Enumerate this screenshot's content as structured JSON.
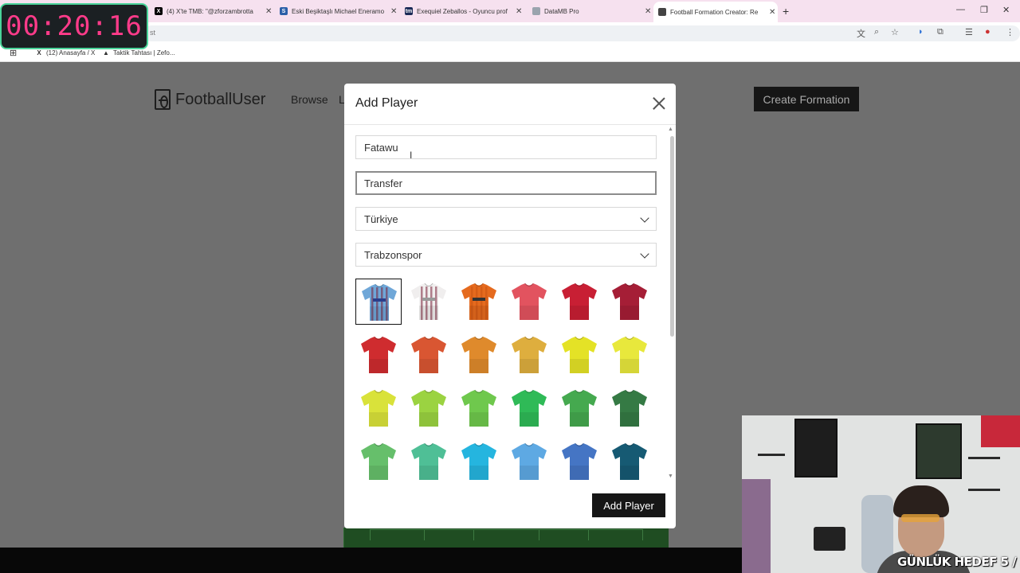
{
  "timer": {
    "text": "00:20:16"
  },
  "browser": {
    "tabs": [
      {
        "title": "(4) X'te TMB: \"@zforzambrotta",
        "icon": "x-icon",
        "fav_bg": "#000000",
        "fav_glyph": "X"
      },
      {
        "title": "Eski Beşiktaşlı Michael Eneramo",
        "icon": "news-icon",
        "fav_bg": "#2b5fa8",
        "fav_glyph": "S"
      },
      {
        "title": "Exequiel Zeballos - Oyuncu prof",
        "icon": "transfermarkt-icon",
        "fav_bg": "#1a2a57",
        "fav_glyph": "tm"
      },
      {
        "title": "DataMB Pro",
        "icon": "globe-icon",
        "fav_bg": "#9aa4ae",
        "fav_glyph": ""
      },
      {
        "title": "Football Formation Creator: Re",
        "icon": "formation-icon",
        "fav_bg": "#444444",
        "fav_glyph": ""
      }
    ],
    "address_fragment": "st",
    "bookmarks": [
      {
        "label": "(12) Anasayfa / X",
        "icon": "x-icon"
      },
      {
        "label": "Taktik Tahtası | Zefo...",
        "icon": "zefo-icon"
      }
    ]
  },
  "site": {
    "brand": "FootballUser",
    "nav": {
      "browse": "Browse",
      "partial": "L"
    },
    "create_button": "Create Formation"
  },
  "modal": {
    "title": "Add Player",
    "name_value": "Fatawu",
    "second_field_value": "Transfer",
    "country_value": "Türkiye",
    "team_value": "Trabzonspor",
    "add_button": "Add Player"
  },
  "kits": [
    {
      "color": "#6fa7d8",
      "stripe": "#7a2038",
      "sponsor": "#2b3f8c",
      "selected": true,
      "label": "trabzonspor-home-kit"
    },
    {
      "color": "#f0eeee",
      "stripe": "#7a2038",
      "sponsor": "#9a9a9a",
      "selected": false,
      "label": "trabzonspor-away-kit"
    },
    {
      "color": "#e56a1e",
      "stripe": "#c85212",
      "sponsor": "#333333",
      "selected": false,
      "label": "trabzonspor-third-kit"
    },
    {
      "color": "#e2535f",
      "selected": false,
      "label": "plain-kit"
    },
    {
      "color": "#c81f34",
      "selected": false,
      "label": "plain-kit"
    },
    {
      "color": "#a51e36",
      "selected": false,
      "label": "plain-kit"
    },
    {
      "color": "#cf2c2f",
      "selected": false,
      "label": "plain-kit"
    },
    {
      "color": "#d95632",
      "selected": false,
      "label": "plain-kit"
    },
    {
      "color": "#df8a2c",
      "selected": false,
      "label": "plain-kit"
    },
    {
      "color": "#deae3e",
      "selected": false,
      "label": "plain-kit"
    },
    {
      "color": "#e4e226",
      "selected": false,
      "label": "plain-kit"
    },
    {
      "color": "#e8e83c",
      "selected": false,
      "label": "plain-kit"
    },
    {
      "color": "#d9e23a",
      "selected": false,
      "label": "plain-kit"
    },
    {
      "color": "#9bd341",
      "selected": false,
      "label": "plain-kit"
    },
    {
      "color": "#6fc84d",
      "selected": false,
      "label": "plain-kit"
    },
    {
      "color": "#2fba57",
      "selected": false,
      "label": "plain-kit"
    },
    {
      "color": "#45a94f",
      "selected": false,
      "label": "plain-kit"
    },
    {
      "color": "#357a44",
      "selected": false,
      "label": "plain-kit"
    },
    {
      "color": "#66bf6b",
      "selected": false,
      "label": "plain-kit"
    },
    {
      "color": "#4fbf96",
      "selected": false,
      "label": "plain-kit"
    },
    {
      "color": "#25b5df",
      "selected": false,
      "label": "plain-kit"
    },
    {
      "color": "#5ea9e3",
      "selected": false,
      "label": "plain-kit"
    },
    {
      "color": "#4575c4",
      "selected": false,
      "label": "plain-kit"
    },
    {
      "color": "#165a73",
      "selected": false,
      "label": "plain-kit"
    }
  ],
  "stream_overlay": {
    "goal_text": "GÜNLÜK HEDEF 5 / 15"
  }
}
